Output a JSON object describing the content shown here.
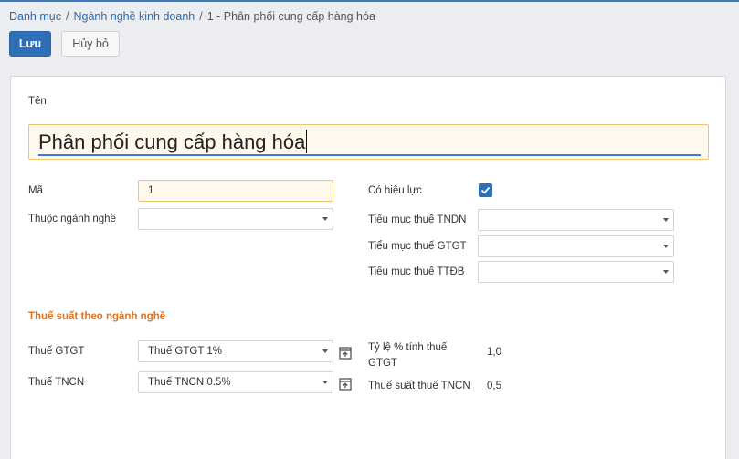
{
  "breadcrumb": {
    "item1": "Danh mục",
    "item2": "Ngành nghề kinh doanh",
    "current": "1 - Phân phối cung cấp hàng hóa",
    "separator": "/"
  },
  "buttons": {
    "save": "Lưu",
    "discard": "Hủy bỏ"
  },
  "form": {
    "name_label": "Tên",
    "name_value": "Phân phối cung cấp hàng hóa",
    "code_label": "Mã",
    "code_value": "1",
    "parent_label": "Thuộc ngành nghề",
    "parent_value": "",
    "active_label": "Có hiệu lực",
    "active_checked": true,
    "tndn_label": "Tiểu mục thuế TNDN",
    "tndn_value": "",
    "gtgt_sub_label": "Tiểu mục thuế GTGT",
    "gtgt_sub_value": "",
    "ttdb_label": "Tiểu mục thuế TTĐB",
    "ttdb_value": "",
    "section_title": "Thuế suất theo ngành nghề",
    "vat_label": "Thuế GTGT",
    "vat_value": "Thuế GTGT 1%",
    "pit_label": "Thuế TNCN",
    "pit_value": "Thuế TNCN 0.5%",
    "vat_rate_label_line1": "Tỷ lệ % tính thuế",
    "vat_rate_label_line2": "GTGT",
    "vat_rate_value": "1,0",
    "pit_rate_label": "Thuế suất thuế TNCN",
    "pit_rate_value": "0,5"
  },
  "colors": {
    "primary": "#2e6fb5",
    "accent_orange": "#e0711b",
    "required_bg": "#fff8ec"
  }
}
